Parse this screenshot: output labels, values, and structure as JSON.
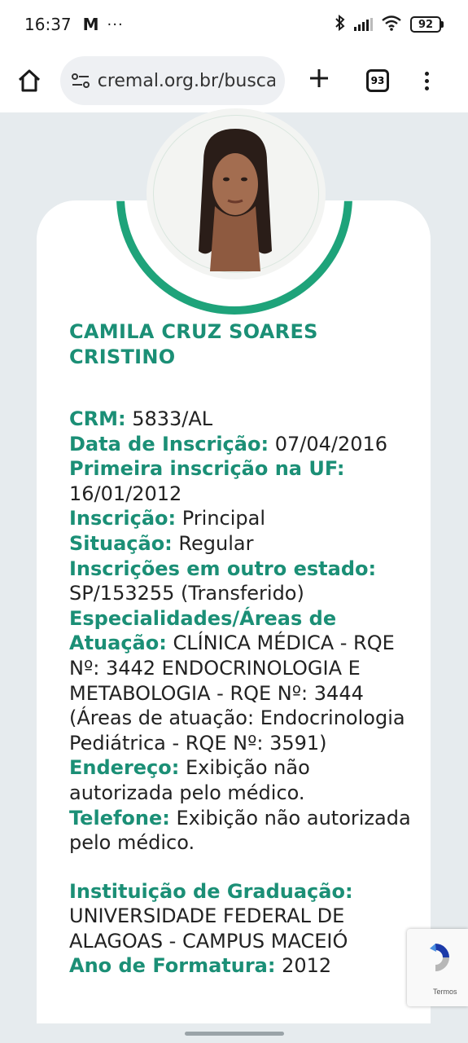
{
  "status_bar": {
    "time": "16:37",
    "mail_icon": "M",
    "more": "···",
    "battery": "92"
  },
  "browser": {
    "url": "cremal.org.br/busca",
    "tab_count": "93"
  },
  "doctor": {
    "name": "CAMILA CRUZ SOARES CRISTINO",
    "fields": [
      {
        "label": "CRM:",
        "value": " 5833/AL"
      },
      {
        "label": "Data de Inscrição:",
        "value": " 07/04/2016"
      },
      {
        "label": "Primeira inscrição na UF:",
        "value": " 16/01/2012"
      },
      {
        "label": "Inscrição:",
        "value": " Principal"
      },
      {
        "label": "Situação:",
        "value": " Regular"
      },
      {
        "label": "Inscrições em outro estado:",
        "value": " SP/153255 (Transferido)"
      },
      {
        "label": "Especialidades/Áreas de Atuação:",
        "value": " CLÍNICA MÉDICA - RQE Nº: 3442 ENDOCRINOLOGIA E METABOLOGIA - RQE Nº: 3444 (Áreas de atuação: Endocrinologia Pediátrica - RQE Nº: 3591)"
      },
      {
        "label": "Endereço:",
        "value": " Exibição não autorizada pelo médico."
      },
      {
        "label": "Telefone:",
        "value": " Exibição não autorizada pelo médico."
      }
    ],
    "graduation": {
      "label": "Instituição de Graduação:",
      "value": " UNIVERSIDADE FEDERAL DE ALAGOAS - CAMPUS MACEIÓ"
    },
    "formatura": {
      "label": "Ano de Formatura:",
      "value": " 2012"
    }
  },
  "recaptcha": {
    "terms": "Termos"
  },
  "colors": {
    "accent": "#1b8f76",
    "ring": "#1ea37a"
  }
}
